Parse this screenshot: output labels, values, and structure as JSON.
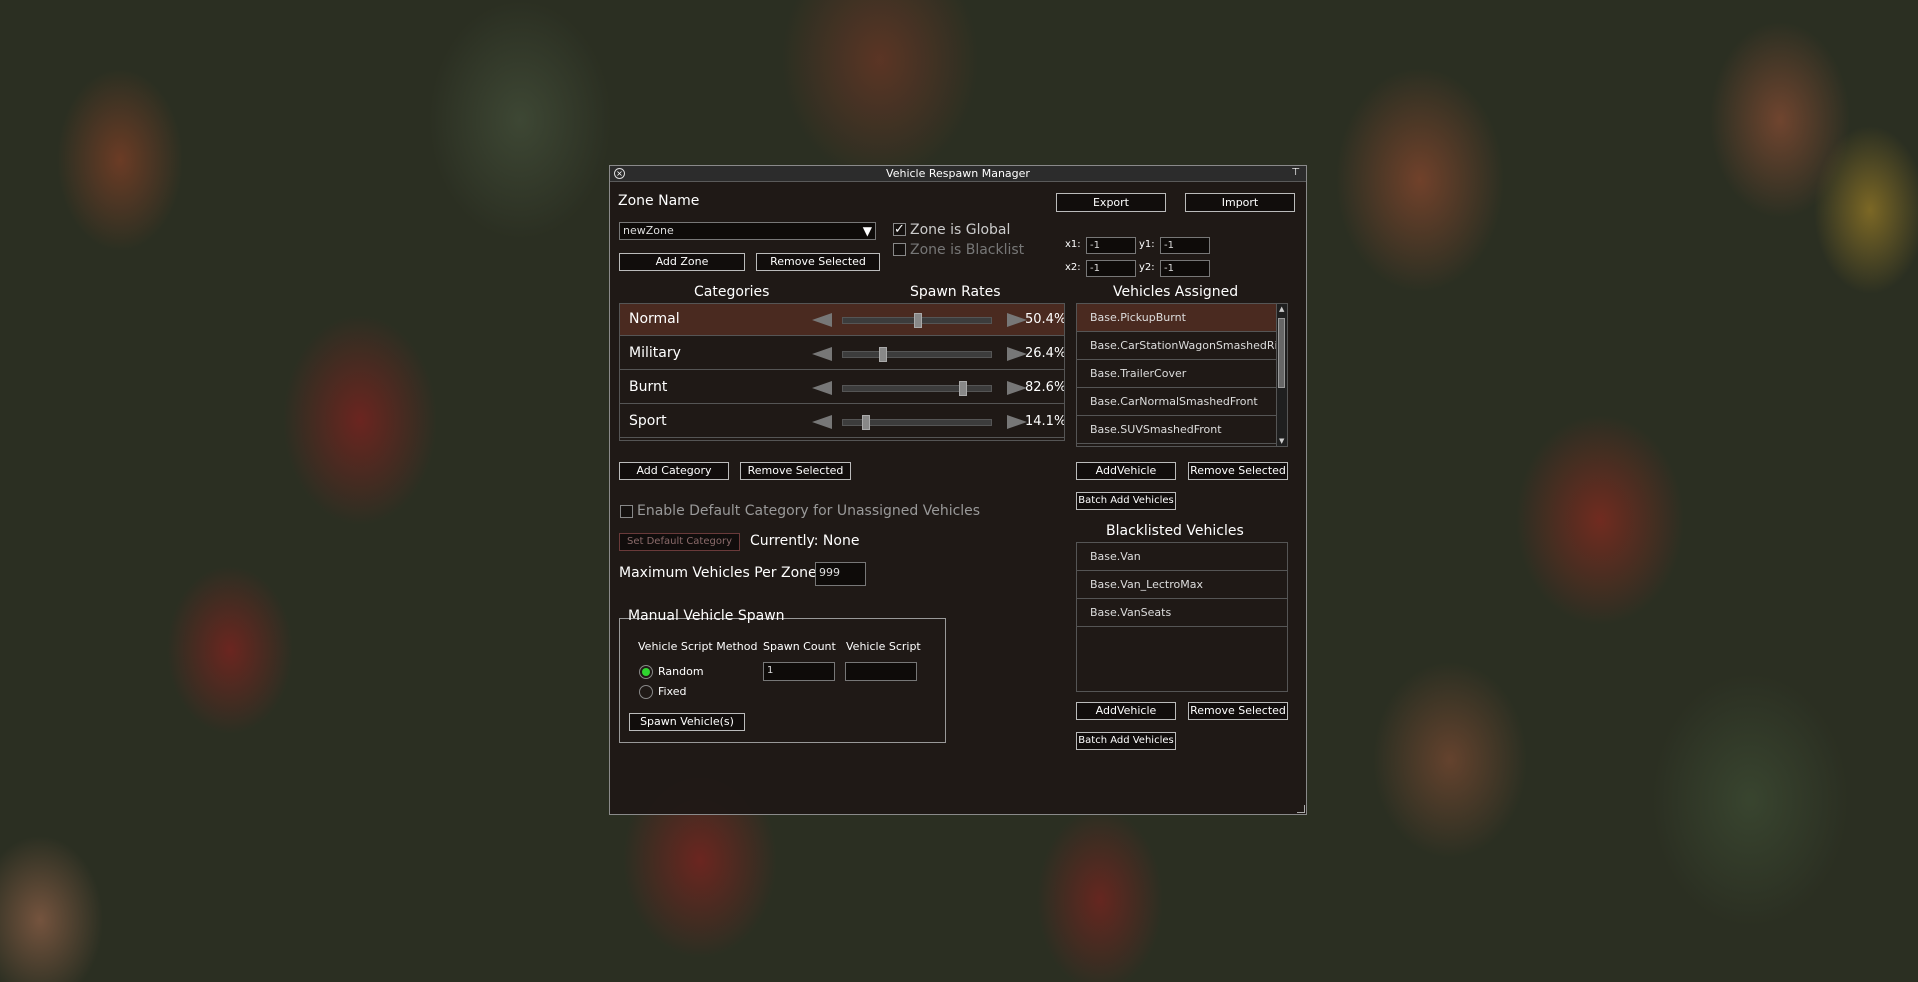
{
  "window": {
    "title": "Vehicle Respawn Manager"
  },
  "zone": {
    "heading": "Zone Name",
    "selected": "newZone",
    "global_label": "Zone is Global",
    "global_checked": true,
    "blacklist_label": "Zone is Blacklist",
    "blacklist_checked": false,
    "add_label": "Add Zone",
    "remove_label": "Remove Selected"
  },
  "io": {
    "export_label": "Export",
    "import_label": "Import"
  },
  "coords": {
    "x1_label": "x1:",
    "x1": "-1",
    "y1_label": "y1:",
    "y1": "-1",
    "x2_label": "x2:",
    "x2": "-1",
    "y2_label": "y2:",
    "y2": "-1"
  },
  "categories": {
    "heading": "Categories",
    "rates_heading": "Spawn Rates",
    "items": [
      {
        "name": "Normal",
        "rate": "50.4%",
        "value": 0.504,
        "selected": true
      },
      {
        "name": "Military",
        "rate": "26.4%",
        "value": 0.264,
        "selected": false
      },
      {
        "name": "Burnt",
        "rate": "82.6%",
        "value": 0.826,
        "selected": false
      },
      {
        "name": "Sport",
        "rate": "14.1%",
        "value": 0.141,
        "selected": false
      }
    ],
    "add_label": "Add Category",
    "remove_label": "Remove Selected"
  },
  "defaults": {
    "enable_label": "Enable Default Category for Unassigned Vehicles",
    "enable_checked": false,
    "set_label": "Set Default Category",
    "current_label": "Currently: None"
  },
  "max": {
    "label": "Maximum Vehicles Per Zone",
    "value": "999"
  },
  "manual": {
    "heading": "Manual Vehicle Spawn",
    "method_label": "Vehicle Script Method",
    "count_label": "Spawn Count",
    "script_label": "Vehicle Script",
    "random_label": "Random",
    "fixed_label": "Fixed",
    "count_value": "1",
    "script_value": "",
    "spawn_label": "Spawn Vehicle(s)"
  },
  "assigned": {
    "heading": "Vehicles Assigned",
    "items": [
      "Base.PickupBurnt",
      "Base.CarStationWagonSmashedRig",
      "Base.TrailerCover",
      "Base.CarNormalSmashedFront",
      "Base.SUVSmashedFront"
    ],
    "add_label": "AddVehicle",
    "remove_label": "Remove Selected",
    "batch_label": "Batch Add Vehicles"
  },
  "blacklisted": {
    "heading": "Blacklisted Vehicles",
    "items": [
      "Base.Van",
      "Base.Van_LectroMax",
      "Base.VanSeats"
    ],
    "add_label": "AddVehicle",
    "remove_label": "Remove Selected",
    "batch_label": "Batch Add Vehicles"
  },
  "icons": {
    "close": "close-icon",
    "pin": "pin-icon",
    "dropdown": "chevron-down-icon",
    "arrow_left": "arrow-left-icon",
    "arrow_right": "arrow-right-icon"
  },
  "colors": {
    "selected_row": "#4a2a20",
    "radio_on": "#2fd62f"
  }
}
